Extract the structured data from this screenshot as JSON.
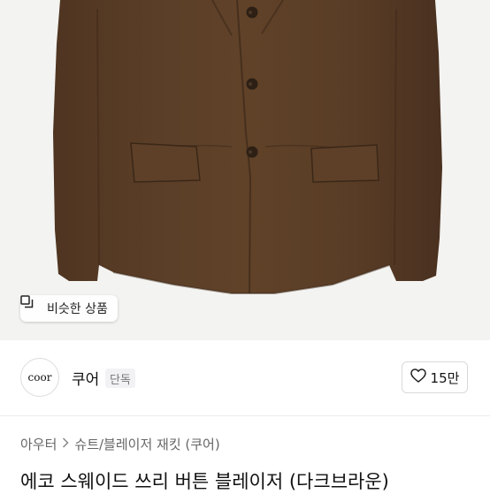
{
  "product_image": {
    "similar_button_label": "비슷한 상품",
    "similar_icon": "copy-icon",
    "jacket_color": "#5a3d26"
  },
  "seller": {
    "avatar_text": "coor",
    "name": "쿠어",
    "badge": "단독",
    "like_icon": "heart-icon",
    "like_count": "15만"
  },
  "breadcrumb": {
    "items": [
      "아우터",
      "슈트/블레이저 재킷 (쿠어)"
    ],
    "separator_icon": "chevron-right-icon"
  },
  "product": {
    "title": "에코 스웨이드 쓰리 버튼 블레이저 (다크브라운)"
  }
}
